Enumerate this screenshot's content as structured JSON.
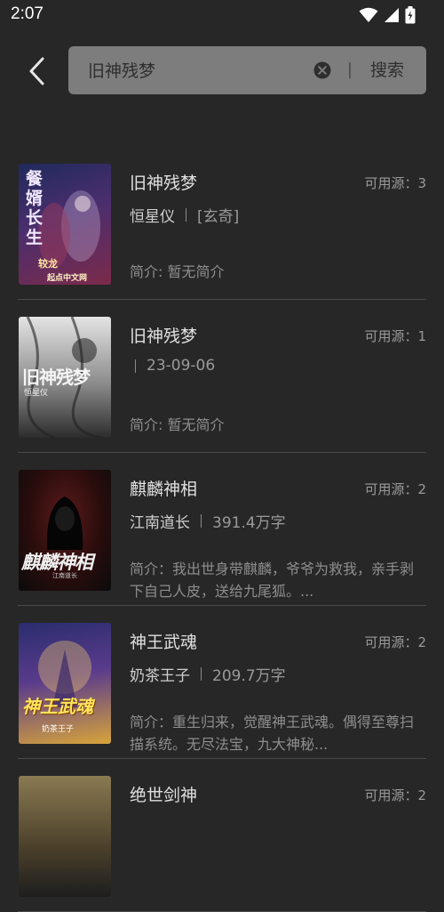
{
  "status_bar": {
    "time": "2:07"
  },
  "search": {
    "query": "旧神残梦",
    "button_label": "搜索"
  },
  "results": [
    {
      "title": "旧神残梦",
      "sources": "可用源：3",
      "author": "恒星仪",
      "kind": "[玄奇]",
      "intro": "简介: 暂无简介",
      "cover": {
        "title_text": "餐婿长生",
        "sub_text": "起点中文网",
        "author_text": "较龙",
        "colors": [
          "#1f2a5c",
          "#7c2a4a"
        ]
      }
    },
    {
      "title": "旧神残梦",
      "sources": "可用源：1",
      "author": "",
      "kind": "23-09-06",
      "intro": "简介: 暂无简介",
      "cover": {
        "title_text": "旧神残梦",
        "sub_text": "恒星仪",
        "colors": [
          "#d8d8d8",
          "#3a3a3a"
        ]
      }
    },
    {
      "title": "麒麟神相",
      "sources": "可用源：2",
      "author": "江南道长",
      "kind": "391.4万字",
      "intro": "简介：我出世身带麒麟，爷爷为救我，亲手剥下自己人皮，送给九尾狐。...",
      "cover": {
        "title_text": "麒麟神相",
        "sub_text": "江南道长",
        "colors": [
          "#3a1414",
          "#0d0d0d"
        ]
      }
    },
    {
      "title": "神王武魂",
      "sources": "可用源：2",
      "author": "奶茶王子",
      "kind": "209.7万字",
      "intro": "简介：重生归来，觉醒神王武魂。偶得至尊扫描系统。无尽法宝，九大神秘...",
      "cover": {
        "title_text": "神王武魂",
        "sub_text": "奶茶王子",
        "colors": [
          "#2a2d6e",
          "#6a3a8a"
        ]
      }
    },
    {
      "title": "绝世剑神",
      "sources": "可用源：2",
      "author": "",
      "kind": "",
      "intro": "",
      "cover": {
        "title_text": "",
        "sub_text": "",
        "colors": [
          "#6b5a3a",
          "#2a2a2a"
        ]
      }
    }
  ]
}
